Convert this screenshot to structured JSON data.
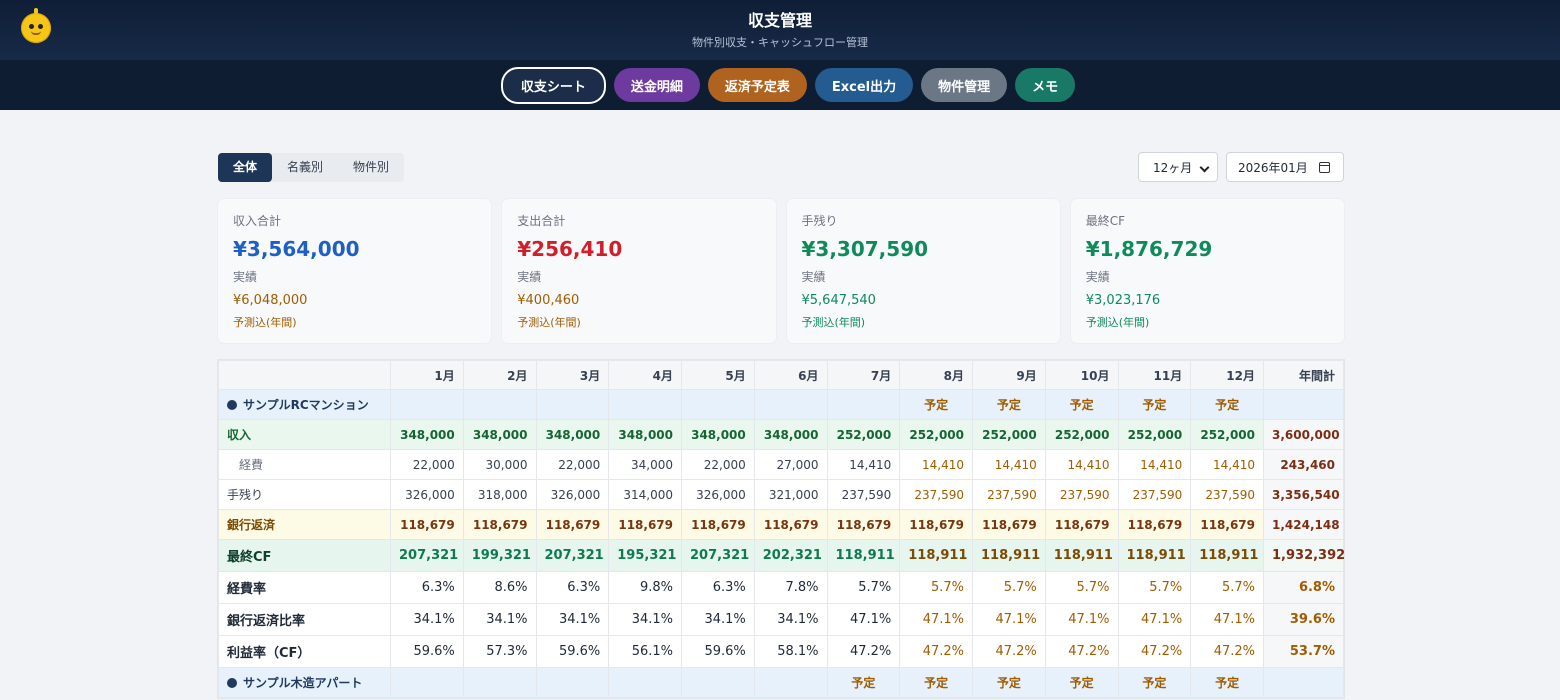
{
  "header": {
    "title": "収支管理",
    "subtitle": "物件別収支・キャッシュフロー管理"
  },
  "nav": [
    {
      "label": "収支シート",
      "active": true
    },
    {
      "label": "送金明細"
    },
    {
      "label": "返済予定表"
    },
    {
      "label": "Excel出力"
    },
    {
      "label": "物件管理"
    },
    {
      "label": "メモ"
    }
  ],
  "filters": {
    "segments": [
      "全体",
      "名義別",
      "物件別"
    ],
    "active_segment": "全体",
    "period": "12ヶ月",
    "start_date": "2026年01月"
  },
  "cards": [
    {
      "label": "収入合計",
      "value": "¥3,564,000",
      "sub": "実績",
      "forecast": "¥6,048,000",
      "forecast_label": "予測込(年間)",
      "color": "#1f5fc4"
    },
    {
      "label": "支出合計",
      "value": "¥256,410",
      "sub": "実績",
      "forecast": "¥400,460",
      "forecast_label": "予測込(年間)",
      "color": "#d11f2a"
    },
    {
      "label": "手残り",
      "value": "¥3,307,590",
      "sub": "実績",
      "forecast": "¥5,647,540",
      "forecast_label": "予測込(年間)",
      "color": "#0f8a5a"
    },
    {
      "label": "最終CF",
      "value": "¥1,876,729",
      "sub": "実績",
      "forecast": "¥3,023,176",
      "forecast_label": "予測込(年間)",
      "color": "#0f8a5a"
    }
  ],
  "table": {
    "months": [
      "1月",
      "2月",
      "3月",
      "4月",
      "5月",
      "6月",
      "7月",
      "8月",
      "9月",
      "10月",
      "11月",
      "12月"
    ],
    "total_header": "年間計",
    "plan_label": "予定",
    "property1": {
      "name": "サンプルRCマンション",
      "rows": {
        "income": {
          "label": "収入",
          "values": [
            "348,000",
            "348,000",
            "348,000",
            "348,000",
            "348,000",
            "348,000",
            "252,000",
            "252,000",
            "252,000",
            "252,000",
            "252,000",
            "252,000"
          ],
          "total": "3,600,000"
        },
        "expense": {
          "label": "経費",
          "values": [
            "22,000",
            "30,000",
            "22,000",
            "34,000",
            "22,000",
            "27,000",
            "14,410",
            "14,410",
            "14,410",
            "14,410",
            "14,410",
            "14,410"
          ],
          "total": "243,460"
        },
        "net": {
          "label": "手残り",
          "values": [
            "326,000",
            "318,000",
            "326,000",
            "314,000",
            "326,000",
            "321,000",
            "237,590",
            "237,590",
            "237,590",
            "237,590",
            "237,590",
            "237,590"
          ],
          "total": "3,356,540"
        },
        "bank": {
          "label": "銀行返済",
          "values": [
            "118,679",
            "118,679",
            "118,679",
            "118,679",
            "118,679",
            "118,679",
            "118,679",
            "118,679",
            "118,679",
            "118,679",
            "118,679",
            "118,679"
          ],
          "total": "1,424,148"
        },
        "cf": {
          "label": "最終CF",
          "values": [
            "207,321",
            "199,321",
            "207,321",
            "195,321",
            "207,321",
            "202,321",
            "118,911",
            "118,911",
            "118,911",
            "118,911",
            "118,911",
            "118,911"
          ],
          "total": "1,932,392"
        },
        "expense_ratio": {
          "label": "経費率",
          "values": [
            "6.3%",
            "8.6%",
            "6.3%",
            "9.8%",
            "6.3%",
            "7.8%",
            "5.7%",
            "5.7%",
            "5.7%",
            "5.7%",
            "5.7%",
            "5.7%"
          ],
          "total": "6.8%"
        },
        "repay_ratio": {
          "label": "銀行返済比率",
          "values": [
            "34.1%",
            "34.1%",
            "34.1%",
            "34.1%",
            "34.1%",
            "34.1%",
            "47.1%",
            "47.1%",
            "47.1%",
            "47.1%",
            "47.1%",
            "47.1%"
          ],
          "total": "39.6%"
        },
        "profit_ratio": {
          "label": "利益率（CF）",
          "values": [
            "59.6%",
            "57.3%",
            "59.6%",
            "56.1%",
            "59.6%",
            "58.1%",
            "47.2%",
            "47.2%",
            "47.2%",
            "47.2%",
            "47.2%",
            "47.2%"
          ],
          "total": "53.7%"
        }
      }
    },
    "property2": {
      "name": "サンプル木造アパート"
    }
  }
}
